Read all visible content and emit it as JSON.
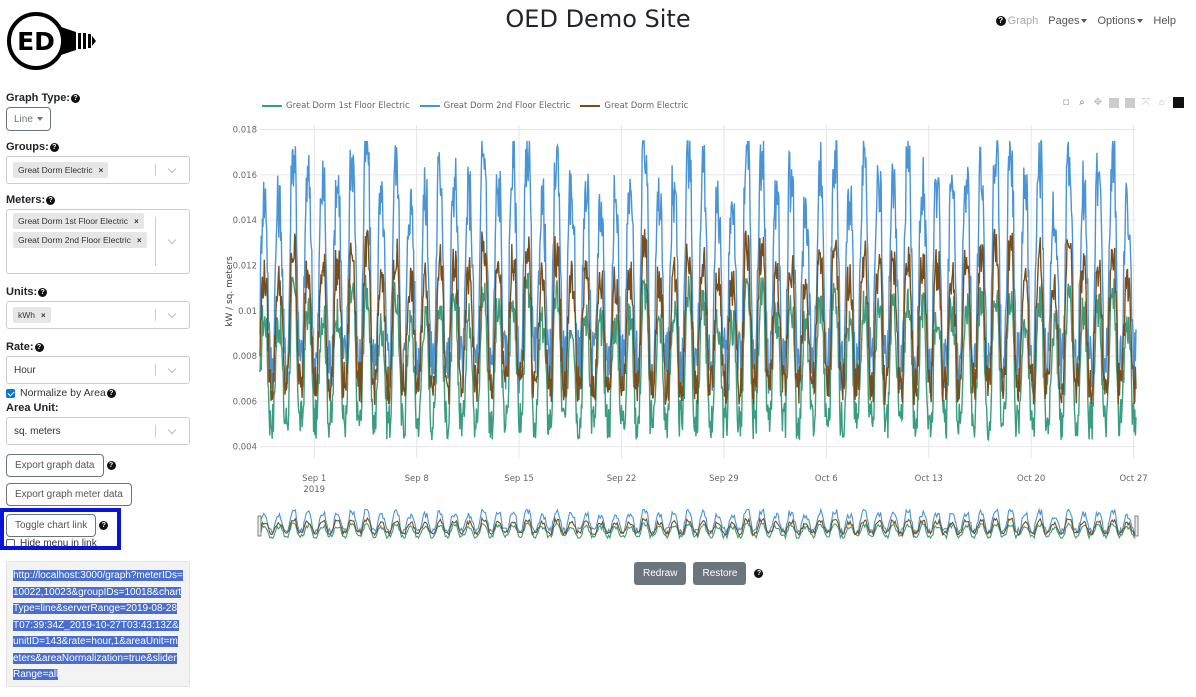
{
  "header": {
    "logo_text": "ED",
    "title": "OED Demo Site",
    "nav": [
      {
        "label": "Graph",
        "disabled": true,
        "icon": "question-circle-icon"
      },
      {
        "label": "Pages",
        "dropdown": true
      },
      {
        "label": "Options",
        "dropdown": true
      },
      {
        "label": "Help"
      }
    ]
  },
  "sidebar": {
    "graph_type": {
      "label": "Graph Type:",
      "value": "Line"
    },
    "groups": {
      "label": "Groups:",
      "selected": [
        "Great Dorm Electric"
      ]
    },
    "meters": {
      "label": "Meters:",
      "selected": [
        "Great Dorm 1st Floor Electric",
        "Great Dorm 2nd Floor Electric"
      ]
    },
    "units": {
      "label": "Units:",
      "selected": [
        "kWh"
      ]
    },
    "rate": {
      "label": "Rate:",
      "value": "Hour"
    },
    "normalize": {
      "label": "Normalize by Area",
      "checked": true
    },
    "area_unit": {
      "label": "Area Unit:",
      "value": "sq. meters"
    },
    "export_graph_data": "Export graph data",
    "export_meter_data": "Export graph meter data",
    "toggle_chart_link": "Toggle chart link",
    "hide_menu": {
      "label": "Hide menu in link",
      "checked": false
    },
    "chart_link": "http://localhost:3000/graph?meterIDs=10022,10023&groupIDs=10018&chartType=line&serverRange=2019-08-28T07:39:34Z_2019-10-27T03:43:13Z&unitID=143&rate=hour,1&areaUnit=meters&areaNormalization=true&sliderRange=all"
  },
  "controls": {
    "redraw": "Redraw",
    "restore": "Restore"
  },
  "modebar": [
    "camera-icon",
    "zoom-icon",
    "pan-icon",
    "zoom-in-icon",
    "zoom-out-icon",
    "autoscale-icon",
    "home-icon",
    "plotly-logo-icon"
  ],
  "chart_data": {
    "type": "line",
    "title": "",
    "xlabel": "",
    "ylabel": "kW / sq. meters",
    "x_range": [
      "2019-08-28T07:00",
      "2019-10-27T04:00"
    ],
    "ylim": [
      0.0035,
      0.0182
    ],
    "y_ticks": [
      0.004,
      0.006,
      0.008,
      0.01,
      0.012,
      0.014,
      0.016,
      0.018
    ],
    "y_tick_labels": [
      "0.004",
      "0.006",
      "0.008",
      "0.01",
      "0.012",
      "0.014",
      "0.016",
      "0.018"
    ],
    "x_ticks": [
      {
        "date": "2019-09-01",
        "label": "Sep 1",
        "sublabel": "2019"
      },
      {
        "date": "2019-09-08",
        "label": "Sep 8"
      },
      {
        "date": "2019-09-15",
        "label": "Sep 15"
      },
      {
        "date": "2019-09-22",
        "label": "Sep 22"
      },
      {
        "date": "2019-09-29",
        "label": "Sep 29"
      },
      {
        "date": "2019-10-06",
        "label": "Oct 6"
      },
      {
        "date": "2019-10-13",
        "label": "Oct 13"
      },
      {
        "date": "2019-10-20",
        "label": "Oct 20"
      },
      {
        "date": "2019-10-27",
        "label": "Oct 27"
      }
    ],
    "grid": true,
    "legend_position": "top-left",
    "range_slider": true,
    "series": [
      {
        "name": "Great Dorm 1st Floor Electric",
        "color": "#3a9c80",
        "base": 0.0052,
        "amp": 0.0052,
        "daily_values_approx": "oscillates daily between ~0.004 and ~0.011"
      },
      {
        "name": "Great Dorm 2nd Floor Electric",
        "color": "#4a94d6",
        "base": 0.0078,
        "amp": 0.0085,
        "daily_values_approx": "oscillates daily between ~0.007 and ~0.0172"
      },
      {
        "name": "Great Dorm Electric",
        "color": "#7a4e1a",
        "base": 0.0068,
        "amp": 0.0055,
        "daily_values_approx": "oscillates daily between ~0.006 and ~0.014"
      }
    ]
  }
}
